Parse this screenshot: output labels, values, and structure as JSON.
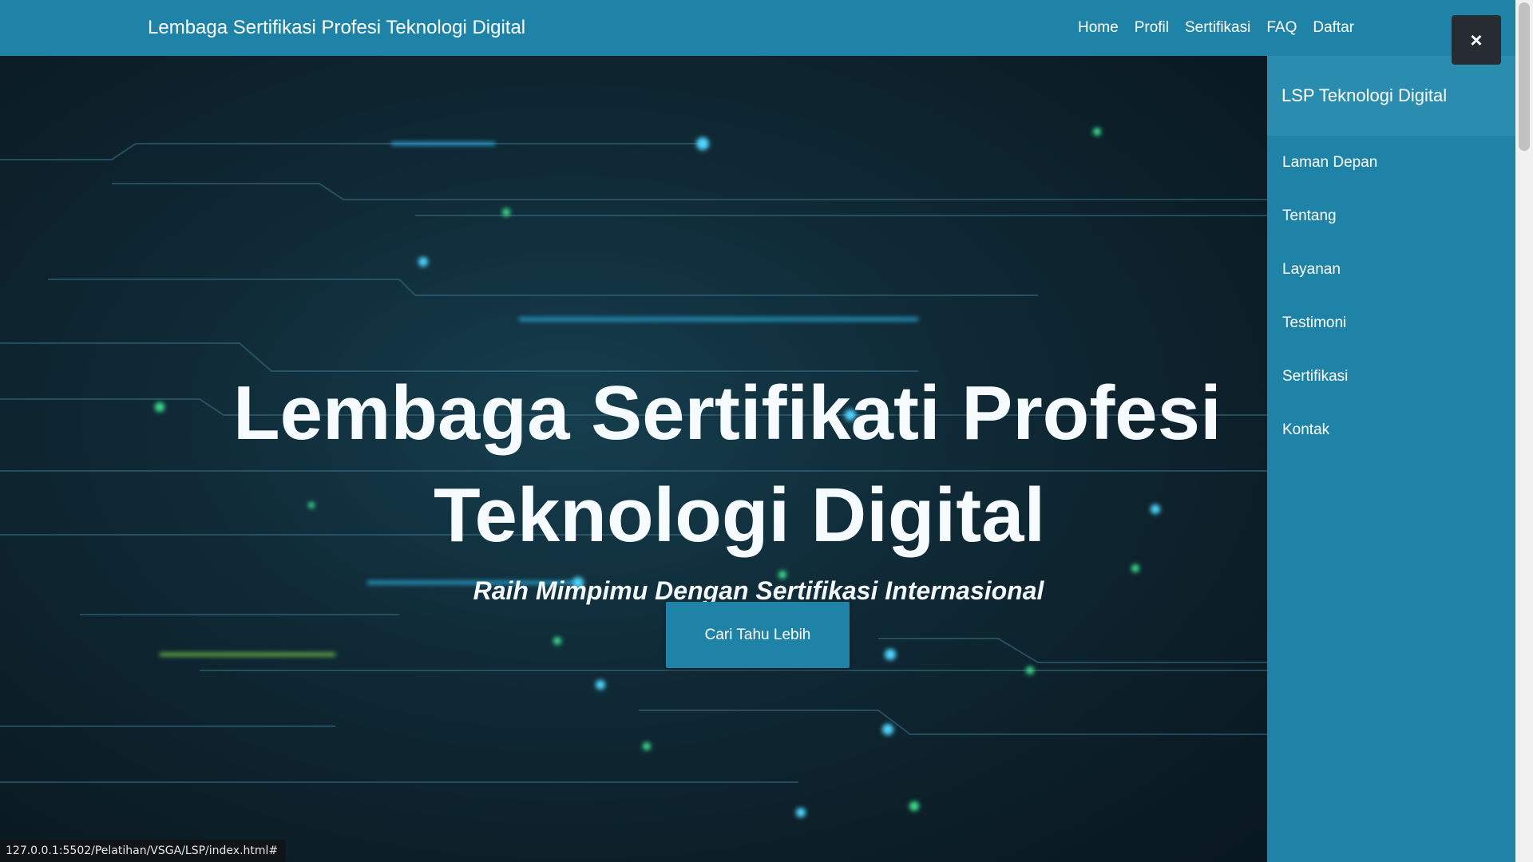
{
  "navbar": {
    "brand": "Lembaga Sertifikasi Profesi Teknologi Digital",
    "links": [
      "Home",
      "Profil",
      "Sertifikasi",
      "FAQ",
      "Daftar"
    ]
  },
  "hero": {
    "title_line1": "Lembaga Sertifikati Profesi",
    "title_line2": "Teknologi Digital",
    "subtitle": "Raih Mimpimu Dengan Sertifikasi Internasional",
    "cta_label": "Cari Tahu Lebih"
  },
  "sidepanel": {
    "title": "LSP Teknologi Digital",
    "items": [
      "Laman Depan",
      "Tentang",
      "Layanan",
      "Testimoni",
      "Sertifikasi",
      "Kontak"
    ],
    "close_icon": "×"
  },
  "statusbar": {
    "url": "127.0.0.1:5502/Pelatihan/VSGA/LSP/index.html#"
  },
  "colors": {
    "primary": "#1e83a6",
    "panel_header": "#2a8db0",
    "close_button": "#262c31"
  }
}
